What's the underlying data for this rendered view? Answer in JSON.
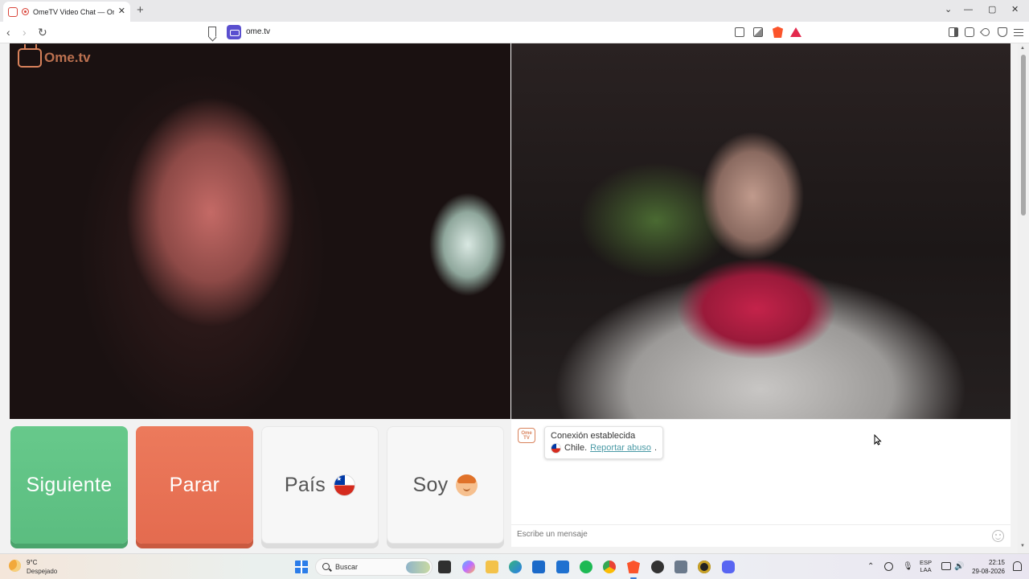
{
  "browser": {
    "tab_title": "OmeTV Video Chat — Omeg",
    "tab_close": "✕",
    "new_tab": "+",
    "url": "ome.tv",
    "window_controls": [
      "⌄",
      "—",
      "▢",
      "✕"
    ]
  },
  "video": {
    "logo_text": "Ome.tv"
  },
  "controls": {
    "next_label": "Siguiente",
    "stop_label": "Parar",
    "country_label": "País",
    "gender_label": "Soy"
  },
  "chat": {
    "logo_text": "Ome TV",
    "status": "Conexión establecida",
    "country": "Chile.",
    "report_link": "Reportar abuso",
    "report_suffix": ".",
    "input_placeholder": "Escribe un mensaje"
  },
  "taskbar": {
    "temperature": "9°C",
    "weather": "Despejado",
    "search_placeholder": "Buscar",
    "language_top": "ESP",
    "language_bottom": "LAA",
    "time": "22:15",
    "date": "29-08-2026"
  },
  "colors": {
    "next_button": "#5bbd80",
    "stop_button": "#e46b4f",
    "accent_link": "#4b9aa6",
    "logo_orange": "#d9825b"
  }
}
